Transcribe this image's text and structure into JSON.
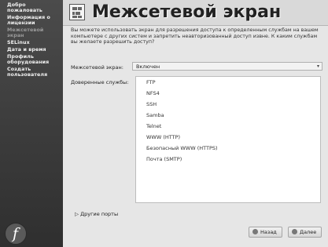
{
  "sidebar": {
    "items": [
      {
        "label": "Добро пожаловать"
      },
      {
        "label": "Информация о лицензии"
      },
      {
        "label": "Межсетевой экран"
      },
      {
        "label": "SELinux"
      },
      {
        "label": "Дата и время"
      },
      {
        "label": "Профиль оборудования"
      },
      {
        "label": "Создать пользователя"
      }
    ],
    "logo_icon": "fedora-logo-icon"
  },
  "header": {
    "title": "Межсетевой экран",
    "icon": "firewall-icon"
  },
  "main": {
    "intro": "Вы можете использовать экран для разрешения доступа к определенным службам на вашем компьютере с других систем и запретить неавторизованный доступ извне. К каким службам вы желаете разрешить доступ?",
    "firewall": {
      "label": "Межсетевой экран:",
      "value": "Включен"
    },
    "trusted": {
      "label": "Доверенные службы:",
      "services": [
        {
          "label": "FTP"
        },
        {
          "label": "NFS4"
        },
        {
          "label": "SSH"
        },
        {
          "label": "Samba"
        },
        {
          "label": "Telnet"
        },
        {
          "label": "WWW (HTTP)"
        },
        {
          "label": "Безопасный WWW (HTTPS)"
        },
        {
          "label": "Почта (SMTP)"
        }
      ]
    },
    "other_ports": "Другие порты"
  },
  "footer": {
    "back_label": "Назад",
    "next_label": "Далее"
  }
}
